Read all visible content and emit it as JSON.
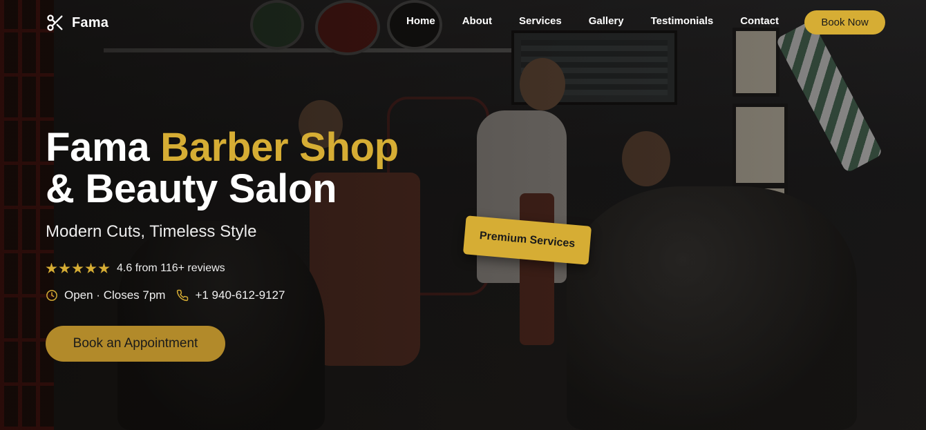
{
  "brand": {
    "name": "Fama",
    "logo_icon": "scissors-icon"
  },
  "nav": {
    "items": [
      {
        "label": "Home"
      },
      {
        "label": "About"
      },
      {
        "label": "Services"
      },
      {
        "label": "Gallery"
      },
      {
        "label": "Testimonials"
      },
      {
        "label": "Contact"
      }
    ],
    "cta_label": "Book Now"
  },
  "hero": {
    "title_part1": "Fama ",
    "title_accent": "Barber Shop",
    "title_line2": "& Beauty Salon",
    "subtitle": "Modern Cuts, Timeless Style",
    "rating": {
      "stars": 5,
      "text": "4.6 from 116+ reviews"
    },
    "hours": "Open · Closes 7pm",
    "phone": "+1 940-612-9127",
    "cta_label": "Book an Appointment",
    "badge": "Premium Services"
  },
  "colors": {
    "accent": "#d6ad34",
    "cta_dark": "#b28a2a",
    "text": "#ffffff"
  }
}
